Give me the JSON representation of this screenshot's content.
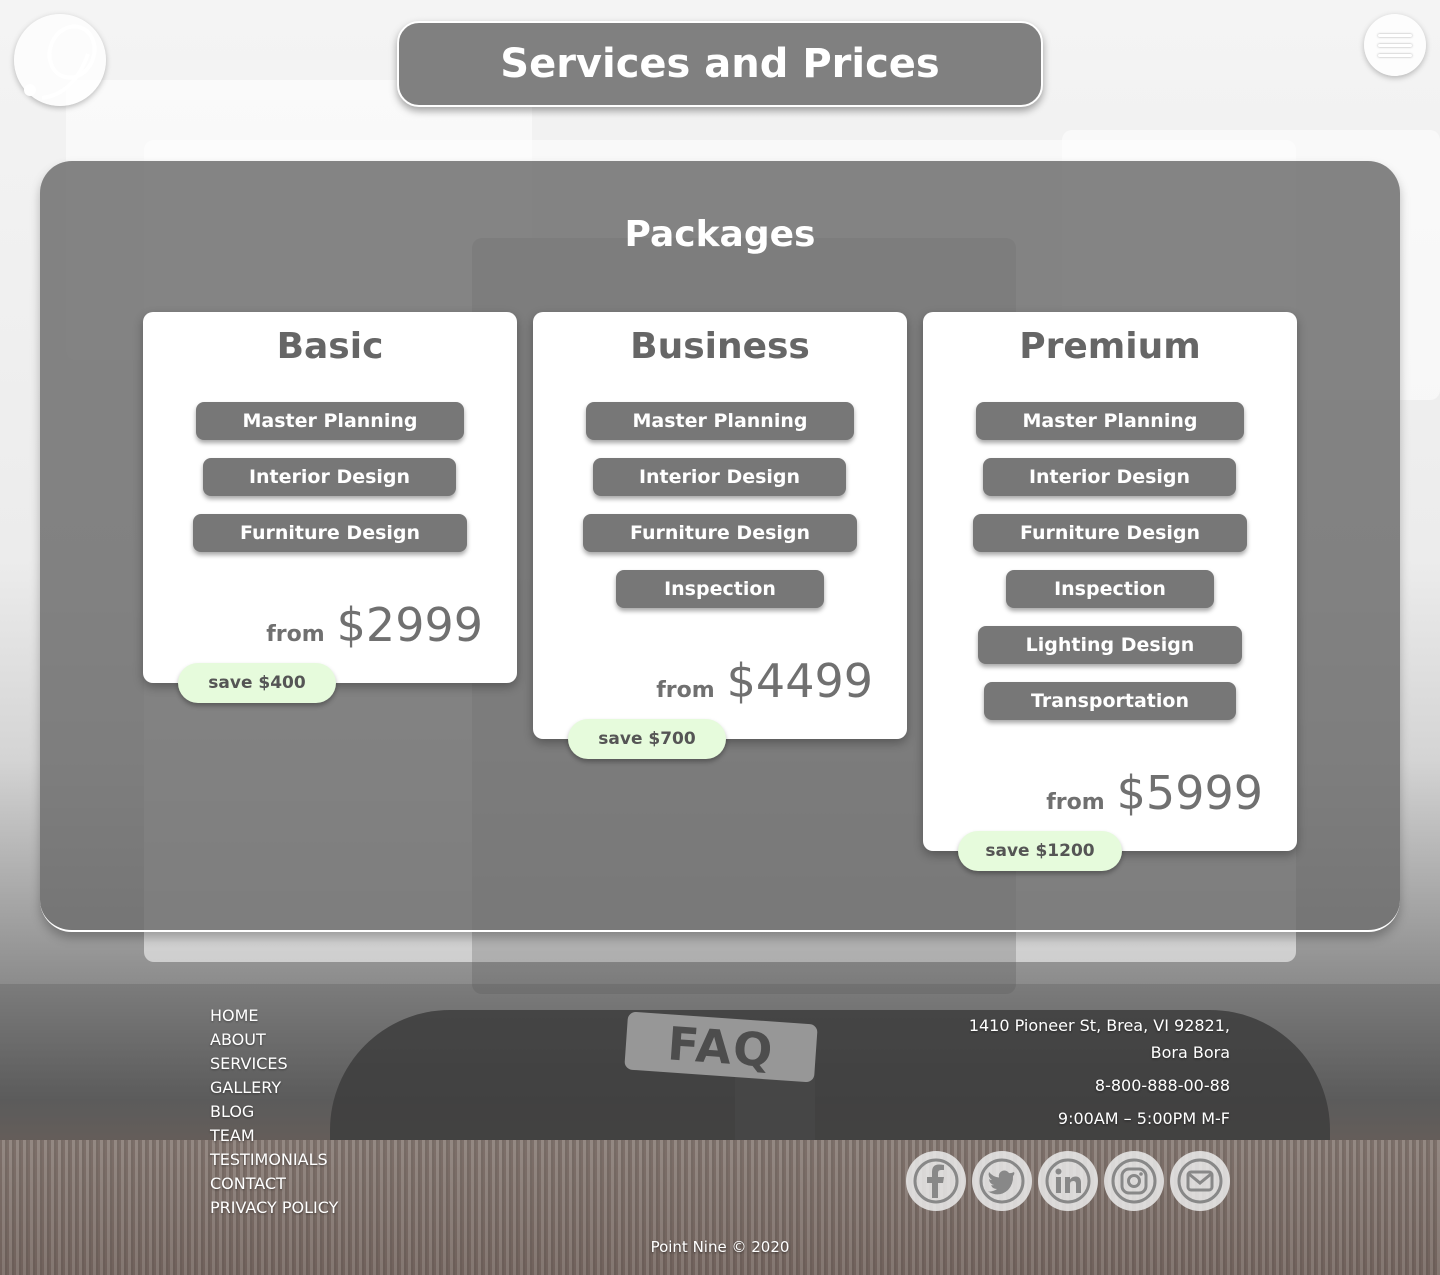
{
  "header": {
    "title": "Services and Prices",
    "logo_icon": "point-nine-logo",
    "menu_icon": "hamburger-menu-icon"
  },
  "packages": {
    "title": "Packages",
    "cards": [
      {
        "name": "Basic",
        "services": [
          "Master Planning",
          "Interior Design",
          "Furniture Design"
        ],
        "price_prefix": "from",
        "price": "$2999",
        "save": "save $400"
      },
      {
        "name": "Business",
        "services": [
          "Master Planning",
          "Interior Design",
          "Furniture Design",
          "Inspection"
        ],
        "price_prefix": "from",
        "price": "$4499",
        "save": "save $700"
      },
      {
        "name": "Premium",
        "services": [
          "Master Planning",
          "Interior Design",
          "Furniture Design",
          "Inspection",
          "Lighting Design",
          "Transportation"
        ],
        "price_prefix": "from",
        "price": "$5999",
        "save": "save $1200"
      }
    ]
  },
  "background": {
    "sign_text": "FAQ"
  },
  "footer": {
    "nav": [
      "HOME",
      "ABOUT",
      "SERVICES",
      "GALLERY",
      "BLOG",
      "TEAM",
      "TESTIMONIALS",
      "CONTACT",
      "PRIVACY POLICY"
    ],
    "address_line1": "1410 Pioneer St, Brea, VI 92821,",
    "address_line2": "Bora Bora",
    "phone": "8-800-888-00-88",
    "hours": "9:00AM – 5:00PM M-F",
    "socials": [
      "facebook-icon",
      "twitter-icon",
      "linkedin-icon",
      "instagram-icon",
      "email-icon"
    ],
    "copyright": "Point Nine © 2020"
  },
  "colors": {
    "panel": "#6e6e6e",
    "service_pill": "#777777",
    "save_badge": "#e6fbdc",
    "card": "#ffffff"
  }
}
